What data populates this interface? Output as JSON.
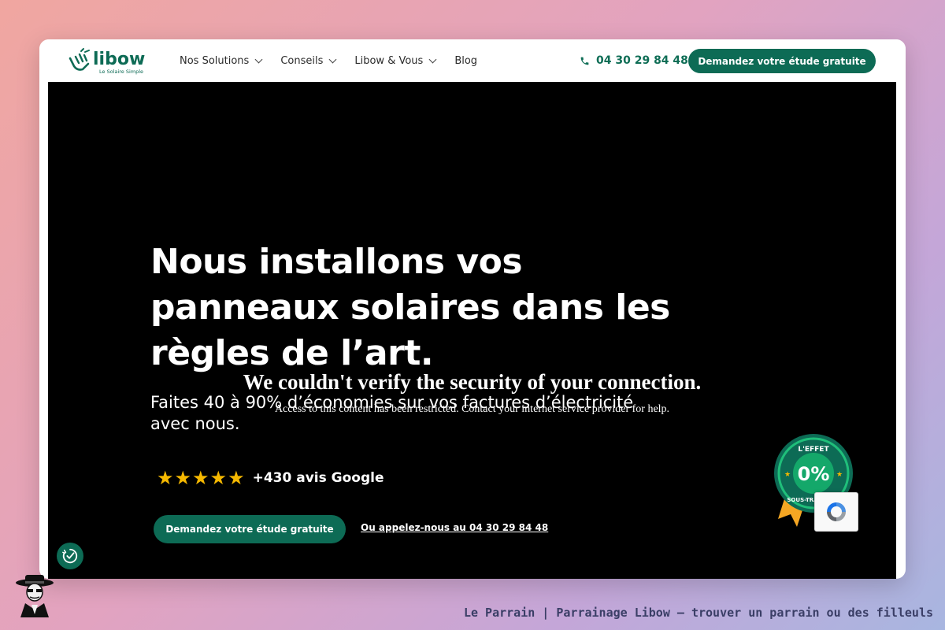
{
  "brand": {
    "name": "libow",
    "tagline": "Le Solaire Simple",
    "color": "#0d6b55"
  },
  "nav": {
    "items": [
      {
        "label": "Nos Solutions",
        "dropdown": true
      },
      {
        "label": "Conseils",
        "dropdown": true
      },
      {
        "label": "Libow & Vous",
        "dropdown": true
      },
      {
        "label": "Blog",
        "dropdown": false
      }
    ]
  },
  "header": {
    "phone": "04 30 29 84 48",
    "cta_label": "Demandez votre étude gratuite"
  },
  "hero": {
    "headline_lines": [
      "Nous installons vos",
      "panneaux solaires dans les",
      "règles de l’art."
    ],
    "subtext_lines": [
      "Faites 40 à 90% d’économies sur vos factures d’électricité",
      "avec nous."
    ],
    "rating": {
      "stars": 5,
      "text": "+430 avis Google"
    },
    "cta_label": "Demandez votre étude gratuite",
    "call_link": "Ou appelez-nous au 04 30 29 84 48",
    "badge": {
      "top": "L'EFFET",
      "value": "0%",
      "bottom": "SOUS-TRAITANCE"
    }
  },
  "security": {
    "title": "We couldn't verify the security of your connection.",
    "message": "Access to this content has been restricted. Contact your internet service provider for help."
  },
  "caption": "Le Parrain | Parrainage Libow — trouver un parrain ou des filleuls",
  "colors": {
    "accent": "#0d6b55",
    "star": "#f5b800",
    "hero_bg": "#000000",
    "badge_ribbon": "#f5a623"
  },
  "icons": [
    "hand-logo-icon",
    "chevron-down-icon",
    "phone-icon",
    "star-icon",
    "recaptcha-icon",
    "accessibility-icon",
    "mascot-icon"
  ]
}
